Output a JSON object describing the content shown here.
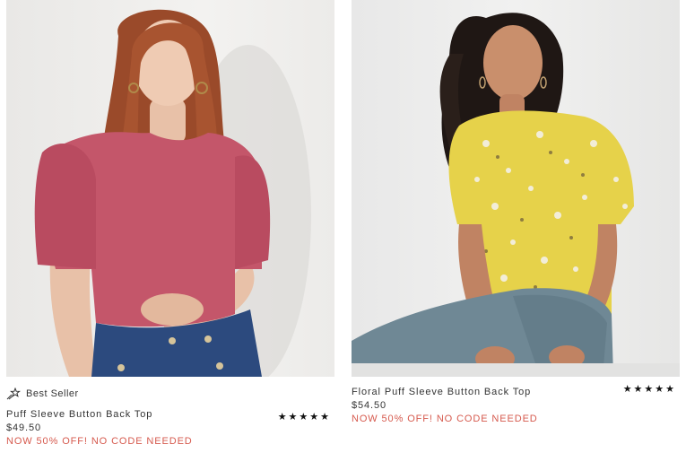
{
  "products": [
    {
      "badge": "Best Seller",
      "badge_icon": "shooting-star-icon",
      "title": "Puff Sleeve Button Back Top",
      "price": "$49.50",
      "promo": "NOW 50% OFF! NO CODE NEEDED",
      "rating": 5,
      "rating_text": "★★★★★",
      "image_alt": "Model wearing rose pink puff sleeve top with blue jeans",
      "colors": {
        "top": "#c4566a",
        "hair": "#9a4a2a",
        "jeans": "#2c4a7e"
      }
    },
    {
      "title": "Floral Puff Sleeve Button Back Top",
      "price": "$54.50",
      "promo": "NOW 50% OFF! NO CODE NEEDED",
      "rating": 5,
      "rating_text": "★★★★★",
      "image_alt": "Model wearing yellow floral puff sleeve top with grey jeans",
      "colors": {
        "top": "#e6d24a",
        "hair": "#1f1714",
        "jeans": "#6f8895"
      }
    }
  ],
  "accent_color": "#d65a4e"
}
